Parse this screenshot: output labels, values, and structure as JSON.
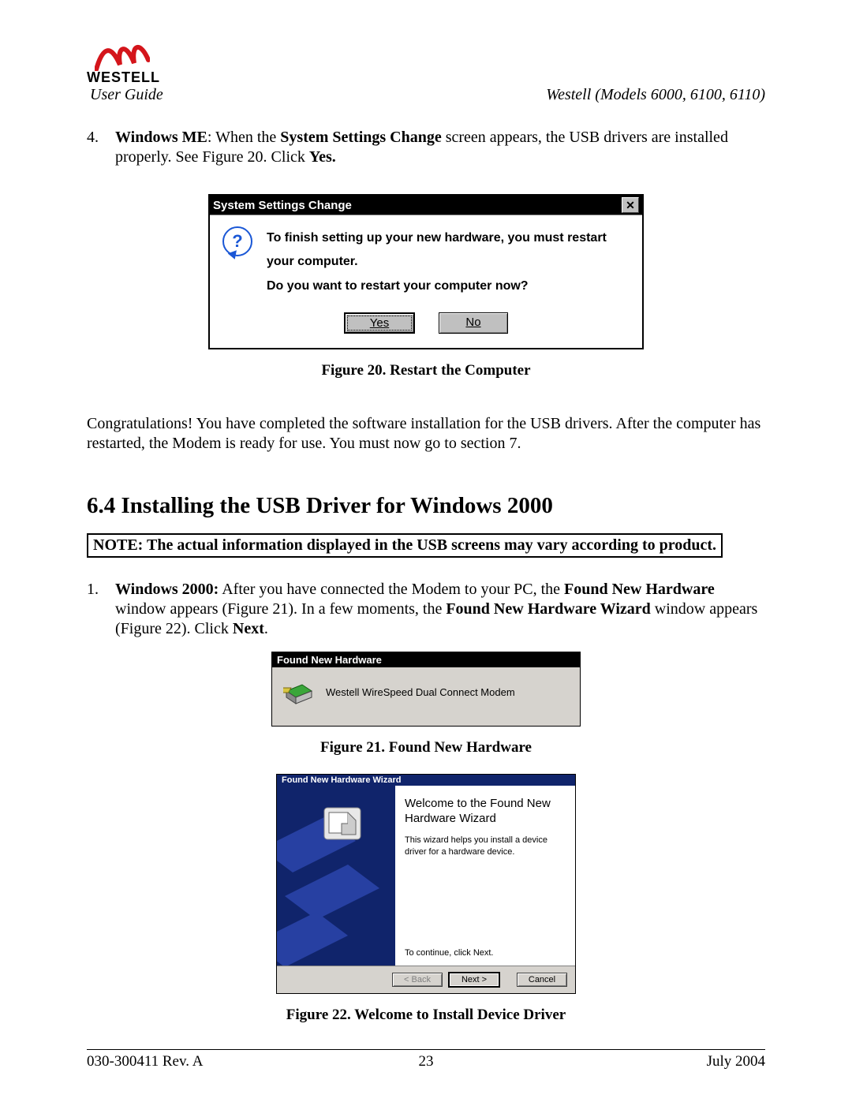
{
  "header": {
    "brand": "WESTELL",
    "user_guide": "User Guide",
    "models": "Westell (Models 6000, 6100, 6110)"
  },
  "step4": {
    "num": "4.",
    "prefix_bold": "Windows ME",
    "text_1": ": When the ",
    "bold_2": "System Settings Change",
    "text_2": " screen appears, the USB drivers are installed properly. See Figure 20. Click ",
    "bold_3": "Yes."
  },
  "dlg1": {
    "title": "System Settings Change",
    "close": "✕",
    "line1": "To finish setting up your new hardware, you must restart your computer.",
    "line2": "Do you want to restart your computer now?",
    "yes": "Yes",
    "no": "No"
  },
  "caption20": "Figure 20. Restart the Computer",
  "congrats": "Congratulations! You have completed the software installation for the USB drivers. After the computer has restarted, the Modem is ready for use. You must now go to section 7.",
  "section_heading": "6.4   Installing the USB Driver for Windows 2000",
  "note": "NOTE: The actual information displayed in the USB screens may vary according to product.",
  "step1": {
    "num": "1.",
    "prefix_bold": "Windows 2000:",
    "text_1": " After you have connected the Modem to your PC, the ",
    "bold_2": "Found New Hardware",
    "text_2": " window appears (Figure 21). In a few moments, the ",
    "bold_3": "Found New Hardware Wizard",
    "text_3": " window appears (Figure 22). Click ",
    "bold_4": "Next",
    "text_4": "."
  },
  "dlg2": {
    "title": "Found New Hardware",
    "text": "Westell WireSpeed Dual Connect Modem"
  },
  "caption21": "Figure 21. Found New Hardware",
  "dlg3": {
    "title": "Found New Hardware Wizard",
    "welcome": "Welcome to the Found New Hardware Wizard",
    "desc": "This wizard helps you install a device driver for a hardware device.",
    "continue": "To continue, click Next.",
    "back": "< Back",
    "next": "Next >",
    "cancel": "Cancel"
  },
  "caption22": "Figure 22. Welcome to Install Device Driver",
  "footer": {
    "left": "030-300411 Rev. A",
    "center": "23",
    "right": "July 2004"
  }
}
